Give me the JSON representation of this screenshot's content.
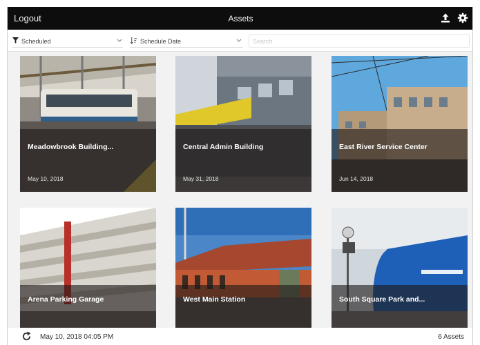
{
  "header": {
    "logout_label": "Logout",
    "title": "Assets",
    "icons": [
      "upload-icon",
      "gear-icon"
    ]
  },
  "filters": {
    "status": {
      "icon": "filter-icon",
      "selected": "Scheduled"
    },
    "sort": {
      "icon": "sort-icon",
      "selected": "Schedule Date"
    },
    "search_placeholder": "Search"
  },
  "assets": [
    {
      "name": "Meadowbrook Building...",
      "date": "May 10, 2018"
    },
    {
      "name": "Central Admin Building",
      "date": "May 31, 2018"
    },
    {
      "name": "East River Service Center",
      "date": "Jun 14, 2018"
    },
    {
      "name": "Arena Parking Garage",
      "date": ""
    },
    {
      "name": "West Main Station",
      "date": ""
    },
    {
      "name": "South Square Park and...",
      "date": ""
    }
  ],
  "footer": {
    "refresh_icon": "refresh-icon",
    "last_updated": "May 10, 2018 04:05 PM",
    "asset_count": "6 Assets"
  },
  "colors": {
    "topbar": "#0d0d0d",
    "background": "#f2f2f2",
    "overlay": "#1e1a18"
  }
}
